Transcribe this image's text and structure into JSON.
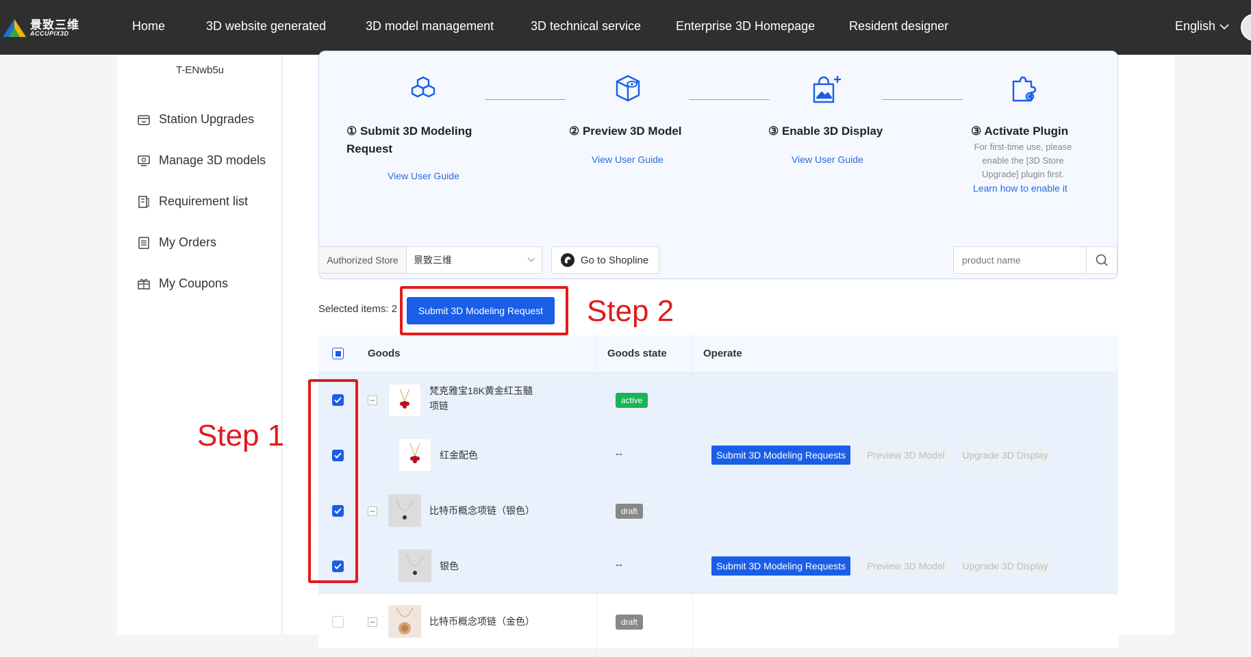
{
  "brand": {
    "name_cn": "景致三维",
    "name_en": "ACCUPIX3D"
  },
  "nav": {
    "items": [
      "Home",
      "3D website  generated",
      "3D model management",
      "3D technical service",
      "Enterprise 3D Homepage",
      "Resident designer"
    ],
    "language": "English"
  },
  "sidebar": {
    "station_id": "T-ENwb5u",
    "items": [
      {
        "label": "Station Upgrades",
        "icon": "store-icon"
      },
      {
        "label": "Manage 3D models",
        "icon": "monitor-icon"
      },
      {
        "label": "Requirement list",
        "icon": "list-icon"
      },
      {
        "label": "My Orders",
        "icon": "orders-icon"
      },
      {
        "label": "My Coupons",
        "icon": "coupon-icon"
      }
    ]
  },
  "guide": {
    "steps": [
      {
        "title": "① Submit 3D Modeling Request",
        "link": "View User Guide",
        "icon": "cubes-icon"
      },
      {
        "title": "② Preview 3D Model",
        "link": "View User Guide",
        "icon": "cube-eye-icon"
      },
      {
        "title": "③ Enable 3D Display",
        "link": "View User Guide",
        "icon": "bag-image-icon"
      },
      {
        "title": "③ Activate Plugin",
        "desc": "For first-time use, please enable the [3D Store Upgrade] plugin first.",
        "link": "Learn how to enable it",
        "icon": "plugin-gear-icon"
      }
    ]
  },
  "filters": {
    "store_label": "Authorized Store",
    "store_value": "景致三维",
    "shopline_label": "Go to Shopline",
    "search_placeholder": "product name"
  },
  "selection": {
    "text": "Selected items: 2",
    "submit_label": "Submit 3D Modeling Request"
  },
  "annotations": {
    "step1": "Step 1",
    "step2": "Step 2",
    "color": "#e01b1b"
  },
  "table": {
    "headers": {
      "goods": "Goods",
      "state": "Goods state",
      "operate": "Operate"
    },
    "rows": [
      {
        "name": "梵克雅宝18K黄金红玉髓项链",
        "state": "active",
        "checked": true,
        "type": "parent"
      },
      {
        "name": "红金配色",
        "state": "--",
        "checked": true,
        "type": "child",
        "ops": [
          "Submit 3D Modeling Requests",
          "Preview 3D Model",
          "Upgrade 3D Display"
        ]
      },
      {
        "name": "比特币概念项链（银色）",
        "state": "draft",
        "checked": true,
        "type": "parent"
      },
      {
        "name": "银色",
        "state": "--",
        "checked": true,
        "type": "child",
        "ops": [
          "Submit 3D Modeling Requests",
          "Preview 3D Model",
          "Upgrade 3D Display"
        ]
      },
      {
        "name": "比特币概念项链（金色）",
        "state": "draft",
        "checked": false,
        "type": "parent"
      }
    ]
  },
  "colors": {
    "primary": "#1a5ee8",
    "active": "#1bb356",
    "draft": "#888888",
    "nav_bg": "#2f2f2f"
  }
}
